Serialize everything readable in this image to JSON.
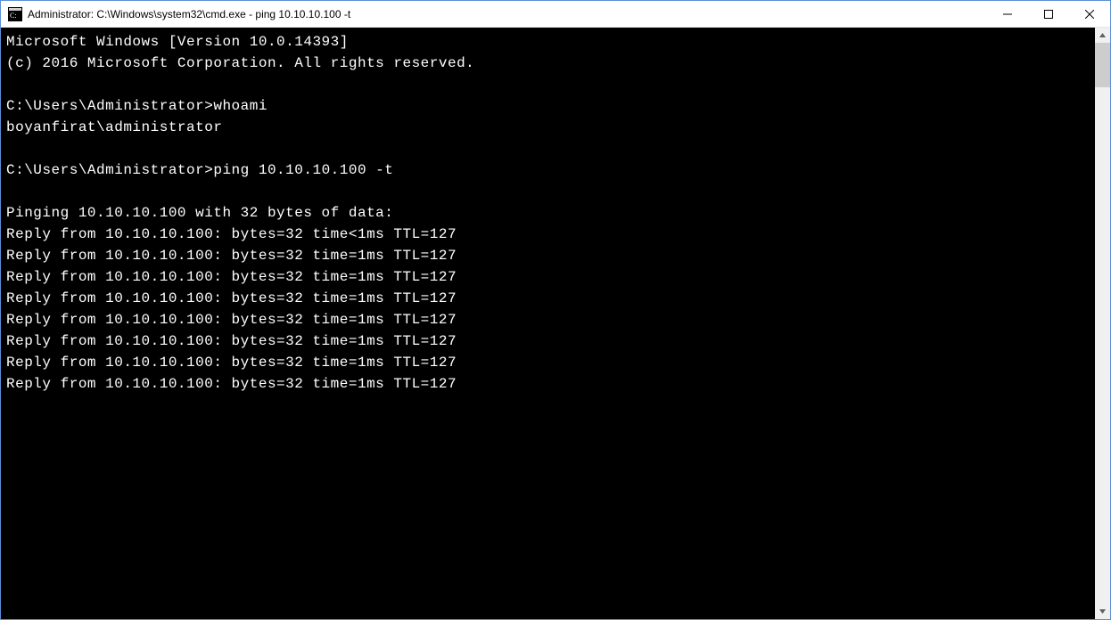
{
  "window": {
    "title": "Administrator: C:\\Windows\\system32\\cmd.exe - ping  10.10.10.100 -t"
  },
  "console": {
    "version_line": "Microsoft Windows [Version 10.0.14393]",
    "copyright_line": "(c) 2016 Microsoft Corporation. All rights reserved.",
    "prompt1": "C:\\Users\\Administrator>",
    "cmd1": "whoami",
    "whoami_output": "boyanfirat\\administrator",
    "prompt2": "C:\\Users\\Administrator>",
    "cmd2": "ping 10.10.10.100 -t",
    "ping_header": "Pinging 10.10.10.100 with 32 bytes of data:",
    "replies": [
      "Reply from 10.10.10.100: bytes=32 time<1ms TTL=127",
      "Reply from 10.10.10.100: bytes=32 time=1ms TTL=127",
      "Reply from 10.10.10.100: bytes=32 time=1ms TTL=127",
      "Reply from 10.10.10.100: bytes=32 time=1ms TTL=127",
      "Reply from 10.10.10.100: bytes=32 time=1ms TTL=127",
      "Reply from 10.10.10.100: bytes=32 time=1ms TTL=127",
      "Reply from 10.10.10.100: bytes=32 time=1ms TTL=127",
      "Reply from 10.10.10.100: bytes=32 time=1ms TTL=127"
    ]
  }
}
